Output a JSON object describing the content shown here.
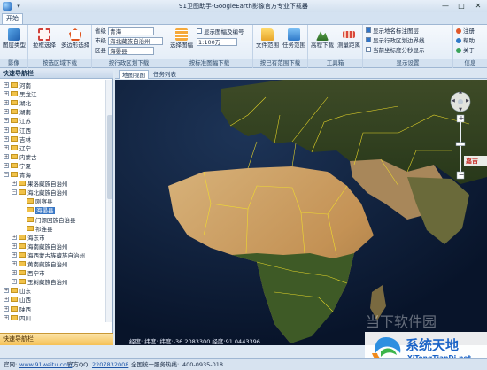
{
  "window": {
    "title": "91卫图助手-GoogleEarth影像官方专业下载器",
    "qat_glyph": "▾",
    "minimize": "—",
    "maximize": "□",
    "close": "✕"
  },
  "ribbon": {
    "tab_home": "开始",
    "groups": {
      "image": {
        "label": "影像",
        "btn_type": "图层类型"
      },
      "select_area": {
        "label": "按选区域下载",
        "btn_rect": "拉框选择",
        "btn_poly": "多边形选择"
      },
      "admin": {
        "label": "按行政区划下载",
        "province_label": "省级",
        "province_value": "青海",
        "city_label": "市级",
        "city_value": "海北藏族自治州",
        "district_label": "区县",
        "district_value": "海晏县"
      },
      "sheet": {
        "label": "按标准图幅下载",
        "btn_select": "选择图幅",
        "chk_show": "显示图幅及编号",
        "scale_value": "1:100万"
      },
      "existing": {
        "label": "按已有范围下载",
        "btn_file": "文件范围",
        "btn_task": "任务范围"
      },
      "tools": {
        "label": "工具箱",
        "btn_hd": "高程下载",
        "btn_measure": "测量距离"
      },
      "display": {
        "label": "显示设置",
        "chk_place": "显示地名标注图层",
        "chk_admin": "显示行政区划边界线",
        "chk_coord": "当前坐标度分秒显示"
      },
      "info": {
        "label": "信息",
        "btn_reg": "注册",
        "btn_help": "帮助",
        "btn_about": "关于"
      }
    }
  },
  "sidebar": {
    "header": "快速导航栏",
    "footer": "快速导航栏",
    "tree": [
      {
        "label": "河南",
        "depth": 1,
        "toggle": "+",
        "folder": true
      },
      {
        "label": "黑龙江",
        "depth": 1,
        "toggle": "+",
        "folder": true
      },
      {
        "label": "湖北",
        "depth": 1,
        "toggle": "+",
        "folder": true
      },
      {
        "label": "湖南",
        "depth": 1,
        "toggle": "+",
        "folder": true
      },
      {
        "label": "江苏",
        "depth": 1,
        "toggle": "+",
        "folder": true
      },
      {
        "label": "江西",
        "depth": 1,
        "toggle": "+",
        "folder": true
      },
      {
        "label": "吉林",
        "depth": 1,
        "toggle": "+",
        "folder": true
      },
      {
        "label": "辽宁",
        "depth": 1,
        "toggle": "+",
        "folder": true
      },
      {
        "label": "内蒙古",
        "depth": 1,
        "toggle": "+",
        "folder": true
      },
      {
        "label": "宁夏",
        "depth": 1,
        "toggle": "+",
        "folder": true
      },
      {
        "label": "青海",
        "depth": 1,
        "toggle": "−",
        "folder": true
      },
      {
        "label": "果洛藏族自治州",
        "depth": 2,
        "toggle": "+",
        "folder": true
      },
      {
        "label": "海北藏族自治州",
        "depth": 2,
        "toggle": "−",
        "folder": true
      },
      {
        "label": "刚察县",
        "depth": 3,
        "toggle": "",
        "folder": true
      },
      {
        "label": "海晏县",
        "depth": 3,
        "toggle": "",
        "folder": true
      },
      {
        "label": "门源回族自治县",
        "depth": 3,
        "toggle": "",
        "folder": true
      },
      {
        "label": "祁连县",
        "depth": 3,
        "toggle": "",
        "folder": true
      },
      {
        "label": "海东市",
        "depth": 2,
        "toggle": "+",
        "folder": true
      },
      {
        "label": "海南藏族自治州",
        "depth": 2,
        "toggle": "+",
        "folder": true
      },
      {
        "label": "海西蒙古族藏族自治州",
        "depth": 2,
        "toggle": "+",
        "folder": true
      },
      {
        "label": "黄南藏族自治州",
        "depth": 2,
        "toggle": "+",
        "folder": true
      },
      {
        "label": "西宁市",
        "depth": 2,
        "toggle": "+",
        "folder": true
      },
      {
        "label": "玉树藏族自治州",
        "depth": 2,
        "toggle": "+",
        "folder": true
      },
      {
        "label": "山东",
        "depth": 1,
        "toggle": "+",
        "folder": true
      },
      {
        "label": "山西",
        "depth": 1,
        "toggle": "+",
        "folder": true
      },
      {
        "label": "陕西",
        "depth": 1,
        "toggle": "+",
        "folder": true
      },
      {
        "label": "四川",
        "depth": 1,
        "toggle": "+",
        "folder": true
      }
    ],
    "selected_index": 14
  },
  "map": {
    "tab_map": "地图视图",
    "tab_tasks": "任务列表",
    "coordinate_text": "经度: 纬度: 纬度:-36.2083300 经度:91.0443396",
    "map_label": "嘉吉",
    "nav": {
      "up": "▲",
      "down": "▼",
      "left": "◀",
      "right": "▶",
      "zoom_in": "+",
      "zoom_out": "−"
    },
    "colors": {
      "ocean": "#0d1b33",
      "land_dark": "#2d3a1d",
      "desert": "#c9a46a",
      "border": "#f4e12a"
    },
    "zoom_level": 0.58
  },
  "statusbar": {
    "website_label": "官网:",
    "website": "www.91weitu.com",
    "qq_label": "官方QQ:",
    "qq": "2207832008",
    "hotline_label": "全国统一服务热线:",
    "hotline": "400-0935-018"
  },
  "overlay": {
    "watermark": "当下软件园",
    "logo_text": "系统天地",
    "logo_sub": "XiTongTianDi.net"
  }
}
